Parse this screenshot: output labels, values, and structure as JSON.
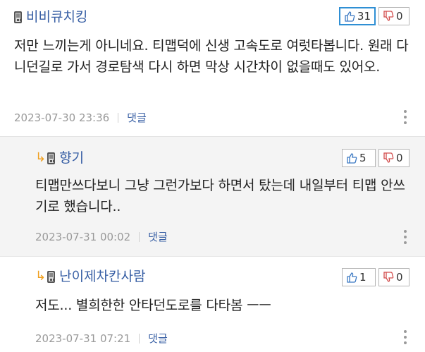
{
  "comments": [
    {
      "username": "비비큐치킹",
      "text": "저만 느끼는게 아니네요. 티맵덕에 신생 고속도로 여럿타봅니다. 원래 다니던길로 가서 경로탐색 다시 하면 막상 시간차이 없을때도 있어오.",
      "up": "31",
      "down": "0",
      "date": "2023-07-30 23:36",
      "reply_label": "댓글"
    },
    {
      "username": "향기",
      "text": "티맵만쓰다보니 그냥 그런가보다 하면서 탔는데 내일부터 티맵 안쓰기로 했습니다..",
      "up": "5",
      "down": "0",
      "date": "2023-07-31 00:02",
      "reply_label": "댓글"
    },
    {
      "username": "난이제차칸사람",
      "text": "저도... 별희한한 안타던도로를 다타봄 ㅡㅡ",
      "up": "1",
      "down": "0",
      "date": "2023-07-31 07:21",
      "reply_label": "댓글"
    }
  ],
  "icons": {
    "reply_arrow": "reply-arrow-icon",
    "phone": "mobile-phone-icon",
    "thumbs_up": "thumbs-up-icon",
    "thumbs_down": "thumbs-down-icon",
    "more": "more-vertical-icon"
  },
  "colors": {
    "username": "#3960a5",
    "active_vote_border": "#2f8fd4",
    "reply_arrow": "#f0a020",
    "meta": "#9a9a9a"
  }
}
